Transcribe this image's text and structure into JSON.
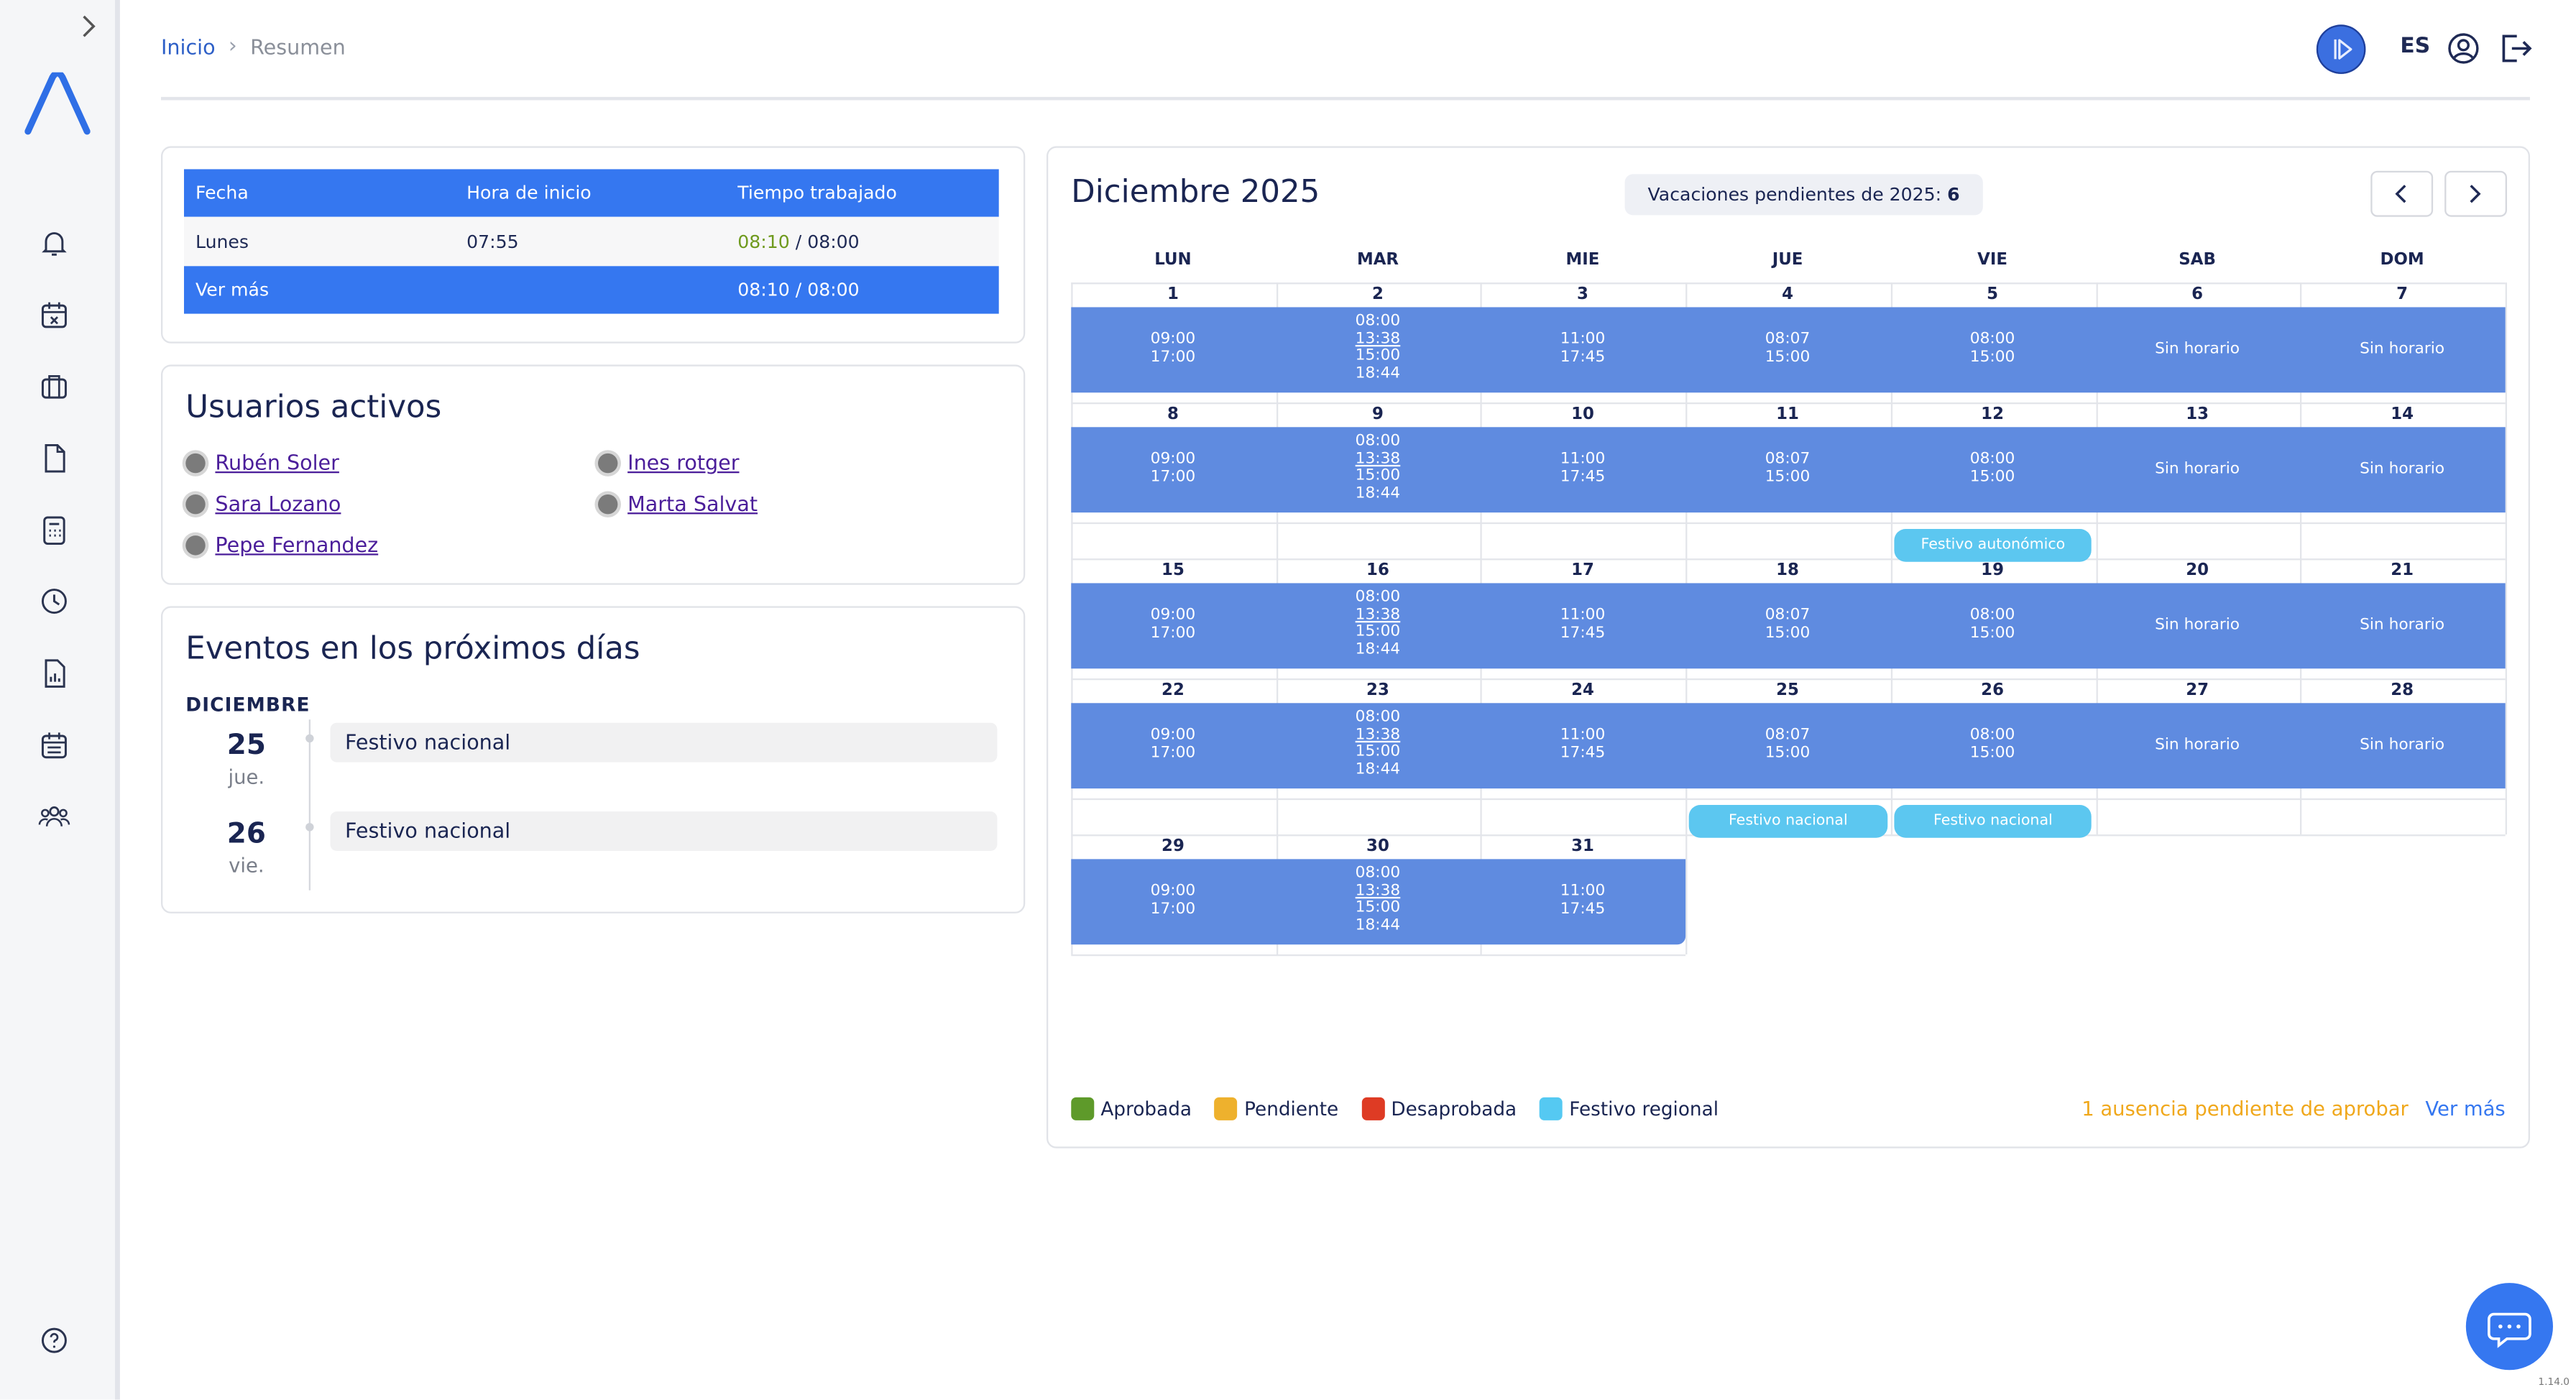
{
  "breadcrumb": {
    "home": "Inicio",
    "current": "Resumen"
  },
  "header": {
    "lang": "ES"
  },
  "time_table": {
    "headers": [
      "Fecha",
      "Hora de inicio",
      "Tiempo trabajado"
    ],
    "row": {
      "day": "Lunes",
      "start": "07:55",
      "worked": "08:10",
      "sep": " / ",
      "target": "08:00"
    },
    "footer": {
      "label": "Ver más",
      "value": "08:10 / 08:00"
    },
    "colors": {
      "header": "#3577f0",
      "worked": "#6f9a1e"
    }
  },
  "active_users": {
    "title": "Usuarios activos",
    "users": [
      "Rubén Soler",
      "Ines rotger",
      "Sara Lozano",
      "Marta Salvat",
      "Pepe Fernandez"
    ]
  },
  "events": {
    "title": "Eventos en los próximos días",
    "month": "DICIEMBRE",
    "items": [
      {
        "day": "25",
        "weekday": "jue.",
        "label": "Festivo nacional"
      },
      {
        "day": "26",
        "weekday": "vie.",
        "label": "Festivo nacional"
      }
    ]
  },
  "calendar": {
    "title": "Diciembre 2025",
    "vacation_label": "Vacaciones pendientes de 2025:",
    "vacation_count": "6",
    "weekdays": [
      "LUN",
      "MAR",
      "MIE",
      "JUE",
      "VIE",
      "SAB",
      "DOM"
    ],
    "sin_horario": "Sin horario",
    "weeks": [
      [
        "1",
        "2",
        "3",
        "4",
        "5",
        "6",
        "7"
      ],
      [
        "8",
        "9",
        "10",
        "11",
        "12",
        "13",
        "14"
      ],
      [
        "15",
        "16",
        "17",
        "18",
        "19",
        "20",
        "21"
      ],
      [
        "22",
        "23",
        "24",
        "25",
        "26",
        "27",
        "28"
      ],
      [
        "29",
        "30",
        "31"
      ]
    ],
    "schedules": {
      "mon": [
        "09:00",
        "17:00"
      ],
      "tue": [
        "08:00",
        "13:38",
        "15:00",
        "18:44"
      ],
      "wed": [
        "11:00",
        "17:45"
      ],
      "thu": [
        "08:07",
        "15:00"
      ],
      "fri": [
        "08:00",
        "15:00"
      ]
    },
    "holidays": {
      "week2_fri": "Festivo autonómico",
      "week4_thu": "Festivo nacional",
      "week4_fri": "Festivo nacional"
    },
    "colors": {
      "bar": "#5f8be0",
      "holiday": "#5cc7f0"
    }
  },
  "legend": [
    {
      "label": "Aprobada",
      "color": "#5e9a2a"
    },
    {
      "label": "Pendiente",
      "color": "#eeb12d"
    },
    {
      "label": "Desaprobada",
      "color": "#de3b24"
    },
    {
      "label": "Festivo regional",
      "color": "#55c9f2"
    }
  ],
  "pending_text": "1 ausencia pendiente de aprobar",
  "ver_mas": "Ver más",
  "version": "1.14.0"
}
